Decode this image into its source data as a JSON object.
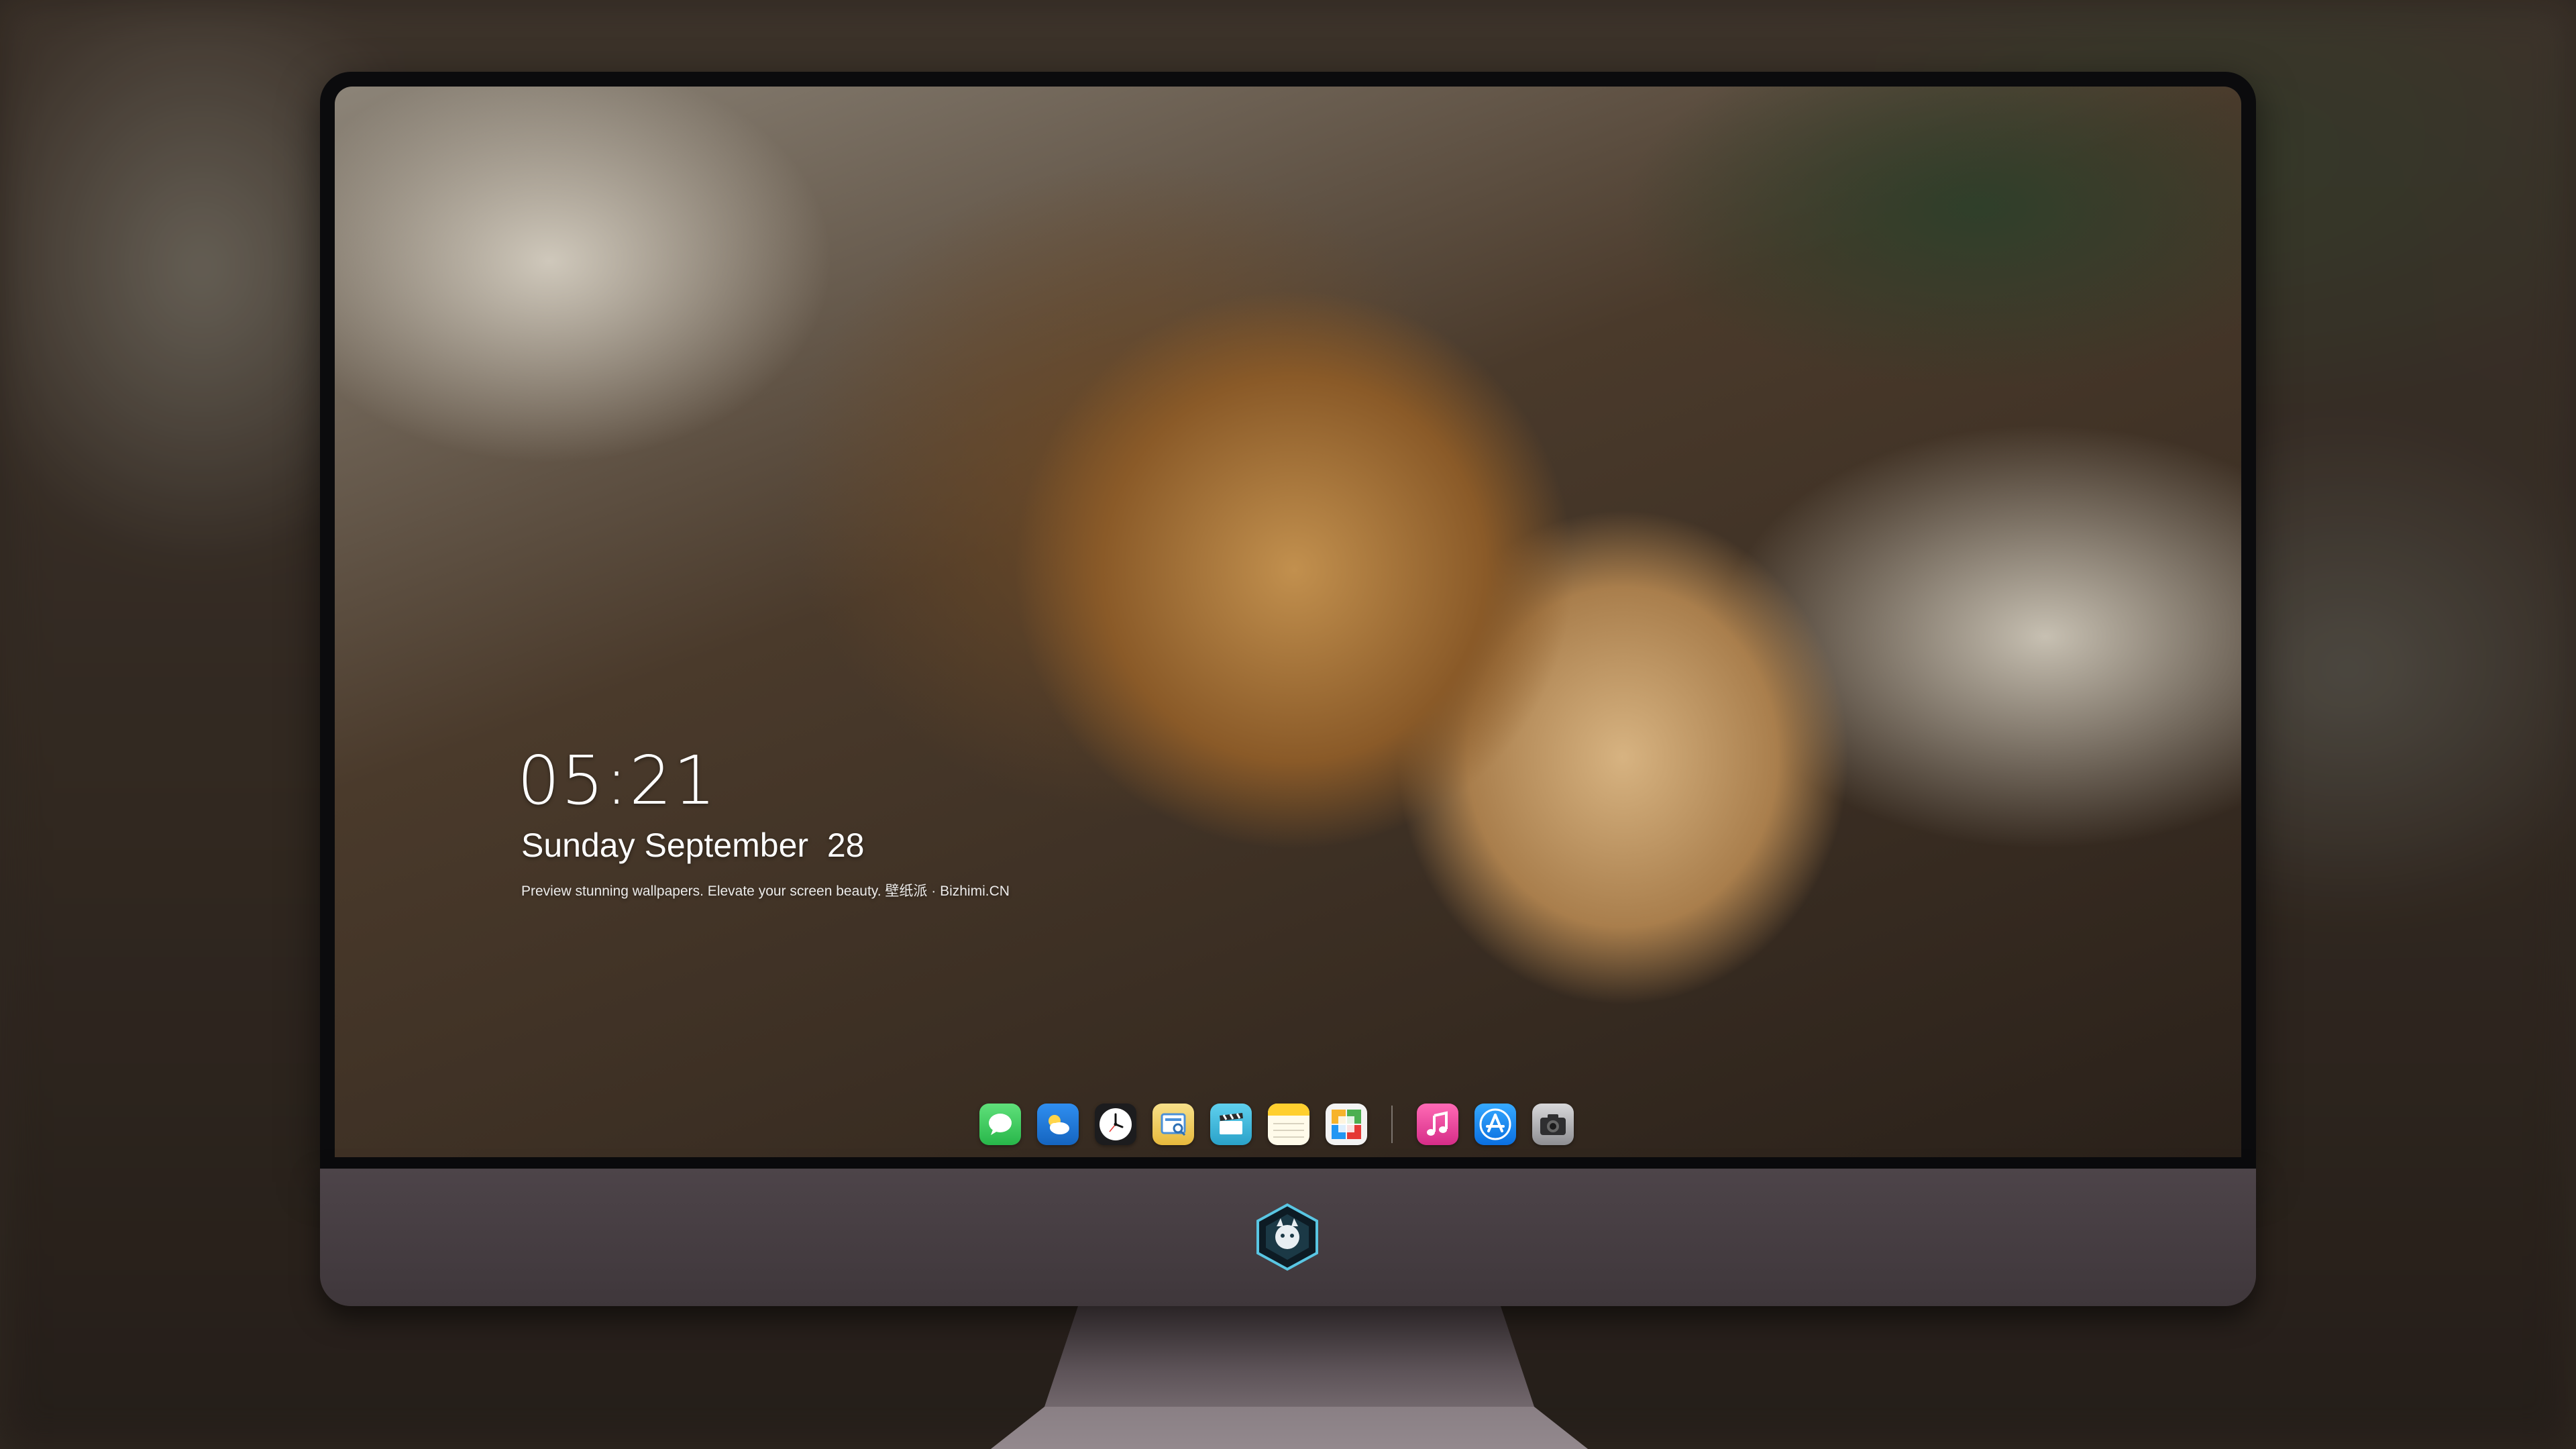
{
  "lock_screen": {
    "time": "05:21",
    "date": "Sunday September  28",
    "caption": "Preview stunning wallpapers. Elevate your screen beauty. 壁纸派 · Bizhimi.CN"
  },
  "dock": {
    "apps": [
      {
        "name": "messages",
        "icon": "messages-icon",
        "color": "#34c759"
      },
      {
        "name": "weather",
        "icon": "weather-icon",
        "color": "#1e88e5"
      },
      {
        "name": "clock",
        "icon": "clock-icon",
        "color": "#1c1c1e"
      },
      {
        "name": "preview",
        "icon": "preview-icon",
        "color": "#f2c94c"
      },
      {
        "name": "clips",
        "icon": "clapperboard-icon",
        "color": "#3ab3d6"
      },
      {
        "name": "notes",
        "icon": "notes-icon",
        "color": "#ffd43b"
      },
      {
        "name": "calendar",
        "icon": "calendar-icon",
        "color": "#4cae4c"
      },
      {
        "name": "music",
        "icon": "music-icon",
        "color": "#f04a9b"
      },
      {
        "name": "app-store",
        "icon": "app-store-icon",
        "color": "#1a8cff"
      },
      {
        "name": "camera",
        "icon": "camera-icon",
        "color": "#5a5a5e"
      }
    ]
  },
  "monitor": {
    "chin_logo": "brand-logo-icon"
  }
}
